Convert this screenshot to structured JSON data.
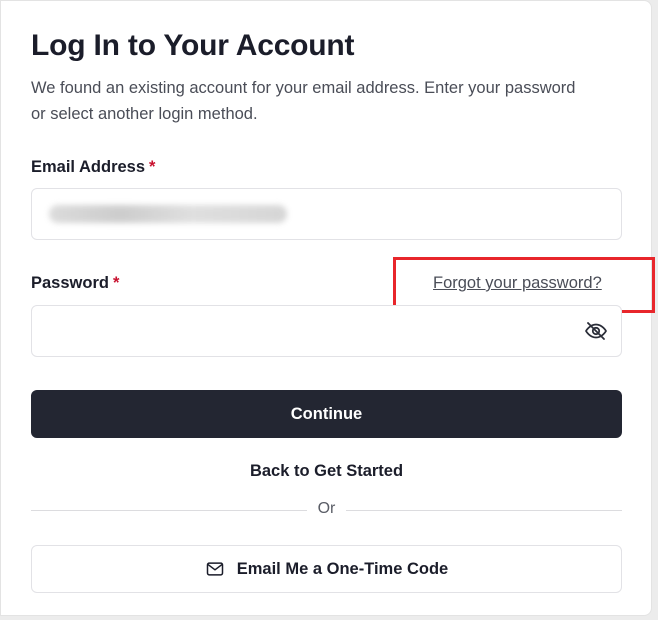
{
  "header": {
    "title": "Log In to Your Account",
    "subtitle": "We found an existing account for your email address. Enter your password or select another login method."
  },
  "email": {
    "label": "Email Address",
    "required_mark": "*",
    "value": ""
  },
  "password": {
    "label": "Password",
    "required_mark": "*",
    "forgot_link": "Forgot your password?",
    "value": ""
  },
  "actions": {
    "continue_label": "Continue",
    "back_label": "Back to Get Started",
    "divider_text": "Or",
    "otp_label": "Email Me a One-Time Code"
  },
  "icons": {
    "password_toggle": "eye-off-icon",
    "otp": "mail-icon"
  },
  "colors": {
    "primary": "#232632",
    "required": "#c8102e",
    "highlight": "#e8262b"
  }
}
